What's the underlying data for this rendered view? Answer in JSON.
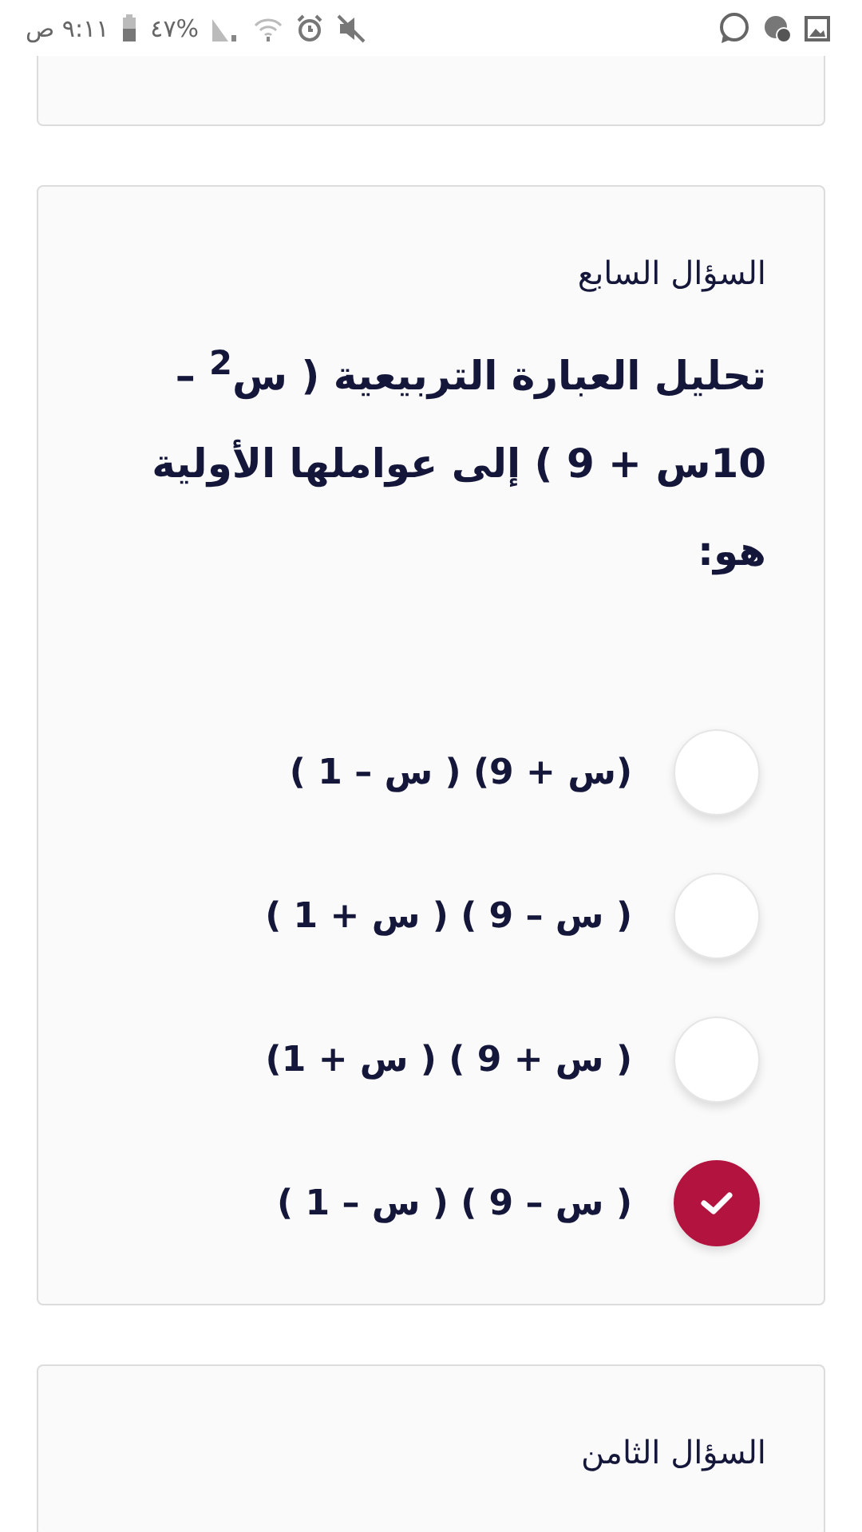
{
  "status_bar": {
    "time": "٩:١١ ص",
    "battery": "%٤٧"
  },
  "questions": [
    {
      "title": "السؤال السابع",
      "text": "تحليل العبارة التربيعية ( س$^{2}$ – 10س + 9 ) إلى عواملها الأولية هو:",
      "options": [
        {
          "label": "(س + 9) ( س – 1 )",
          "selected": false
        },
        {
          "label": "( س – 9 ) ( س + 1 )",
          "selected": false
        },
        {
          "label": "( س + 9 ) ( س + 1)",
          "selected": false
        },
        {
          "label": "( س – 9 ) ( س – 1 )",
          "selected": true
        }
      ]
    },
    {
      "title": "السؤال الثامن"
    }
  ]
}
